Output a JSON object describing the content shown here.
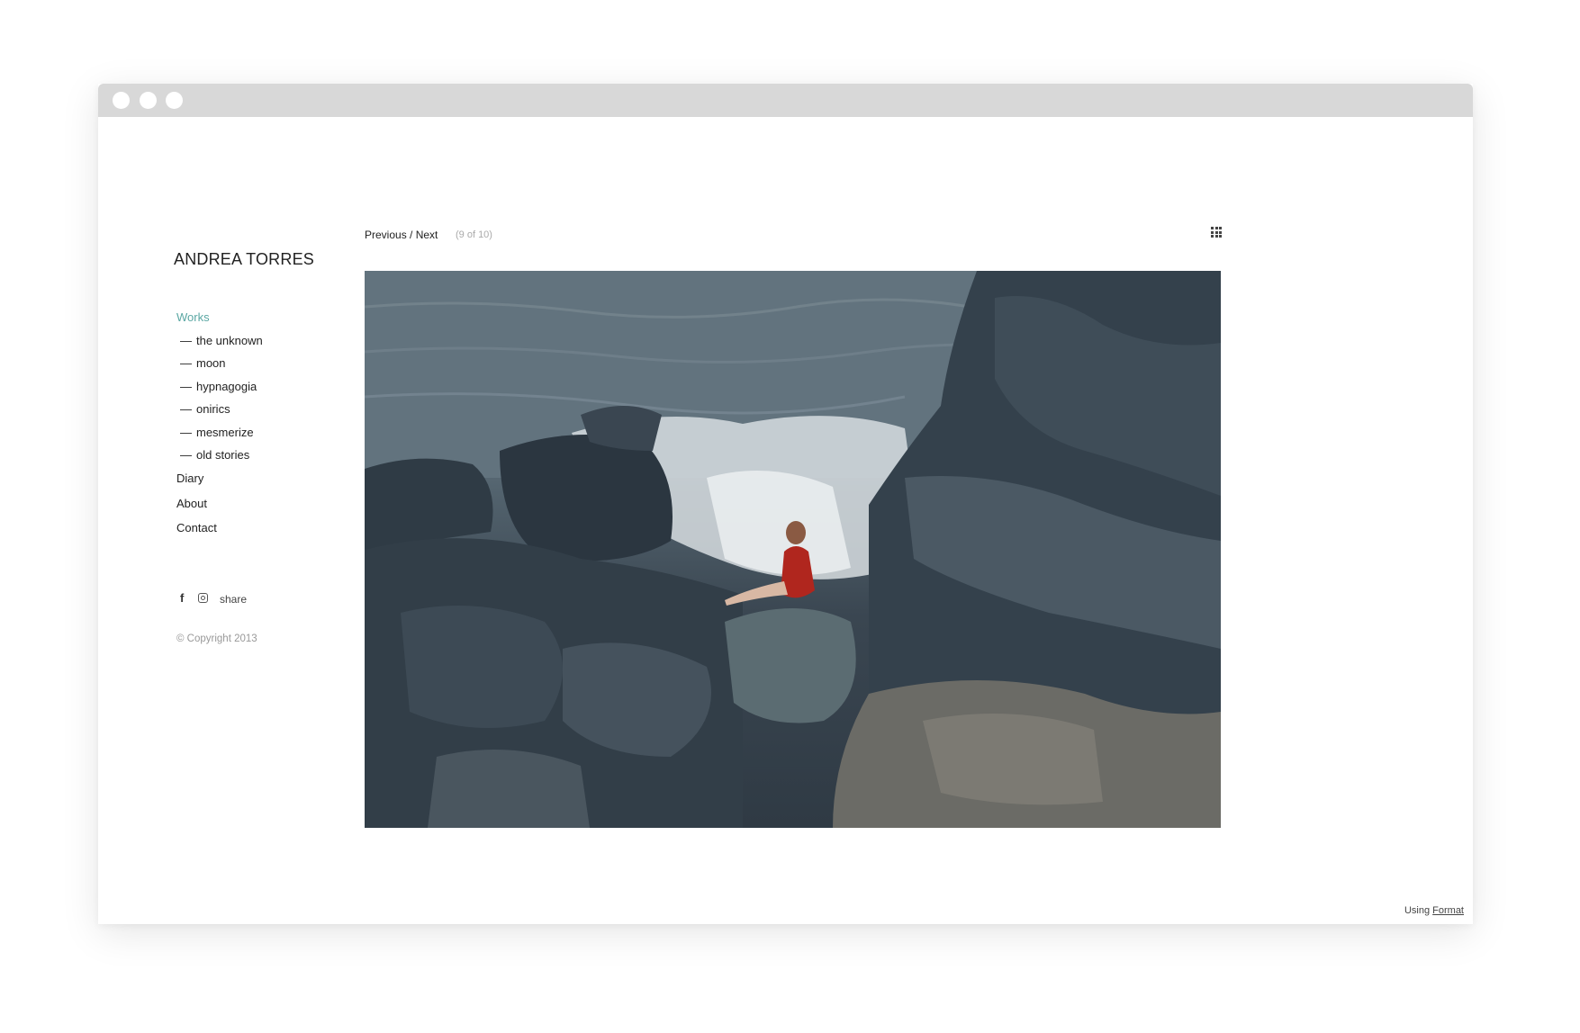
{
  "site": {
    "title": "ANDREA TORRES"
  },
  "nav": {
    "works": "Works",
    "sub_items": [
      "the unknown",
      "moon",
      "hypnagogia",
      "onirics",
      "mesmerize",
      "old stories"
    ],
    "dash": "—",
    "diary": "Diary",
    "about": "About",
    "contact": "Contact"
  },
  "social": {
    "facebook": "f",
    "share": "share"
  },
  "copyright": "© Copyright 2013",
  "gallery": {
    "pager": "Previous / Next",
    "counter": "(9 of 10)"
  },
  "footer": {
    "using": "Using",
    "format": "Format"
  },
  "colors": {
    "accent": "#5aa7a3",
    "titlebar": "#d8d8d8"
  }
}
